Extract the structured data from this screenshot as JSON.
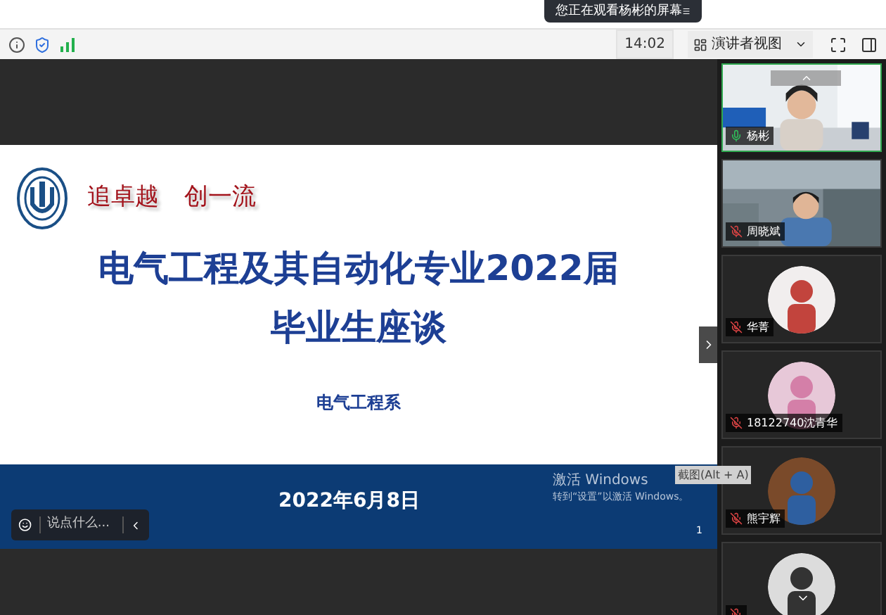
{
  "top_banner": {
    "text": "您正在观看杨彬的屏幕"
  },
  "toolbar": {
    "time": "14:02",
    "view_button": "演讲者视图"
  },
  "slide": {
    "slogan": [
      "追卓越",
      "创一流"
    ],
    "title_lines": [
      "电气工程及其自动化专业2022届",
      "毕业生座谈"
    ],
    "department": "电气工程系",
    "date": "2022年6月8日",
    "page_number": "1"
  },
  "windows_notice": {
    "title": "激活 Windows",
    "subtitle": "转到“设置”以激活 Windows。"
  },
  "tooltip": "截图(Alt + A)",
  "chat_bar": {
    "placeholder": "说点什么..."
  },
  "participants": [
    {
      "name": "杨彬",
      "kind": "video",
      "muted": false,
      "active": true
    },
    {
      "name": "周晓斌",
      "kind": "video",
      "muted": true,
      "active": false
    },
    {
      "name": "华菁",
      "kind": "avatar",
      "muted": true,
      "active": false
    },
    {
      "name": "18122740沈青华",
      "kind": "avatar",
      "muted": true,
      "active": false
    },
    {
      "name": "熊宇辉",
      "kind": "avatar",
      "muted": true,
      "active": false
    },
    {
      "kind": "avatar",
      "muted": true,
      "active": false
    }
  ]
}
